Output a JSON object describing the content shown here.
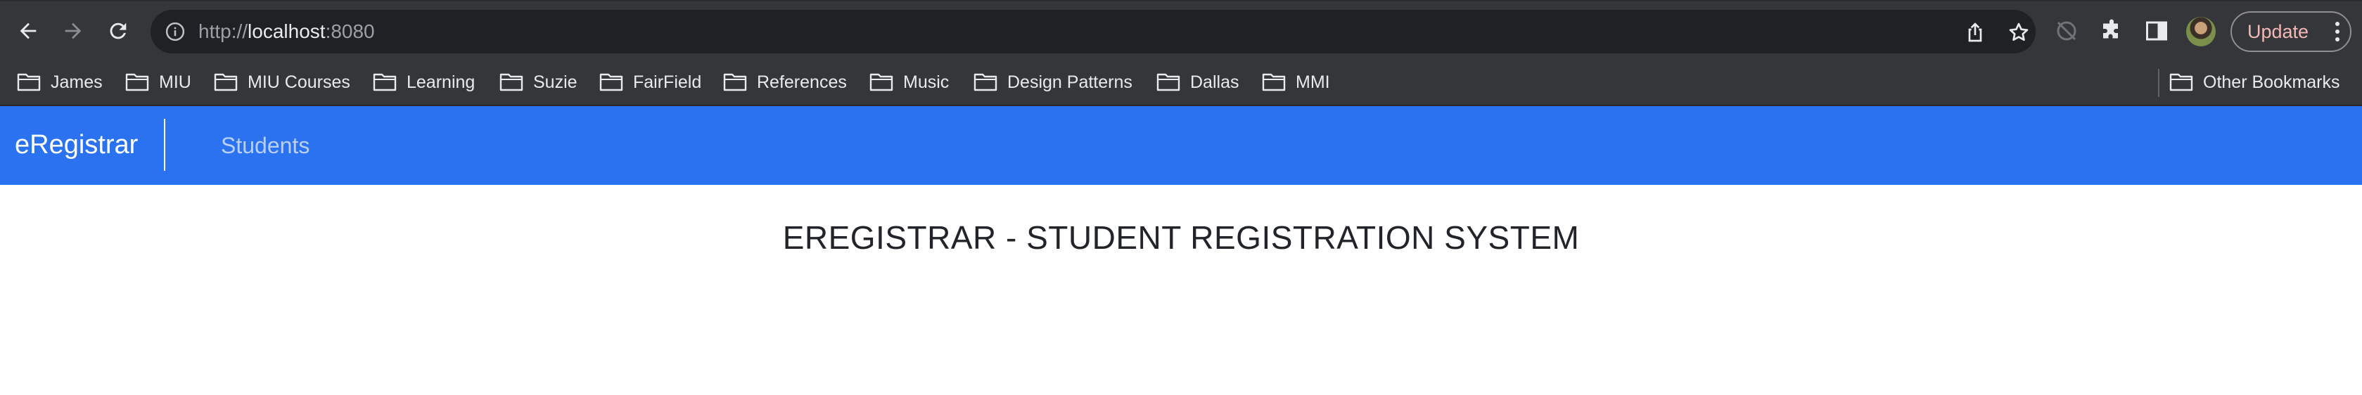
{
  "browser": {
    "url_scheme": "http://",
    "url_host": "localhost",
    "url_port": ":8080",
    "update_label": "Update",
    "icons": [
      "back-icon",
      "forward-icon",
      "reload-icon",
      "info-icon",
      "share-icon",
      "star-icon",
      "sync-off-icon",
      "extensions-icon",
      "side-panel-icon",
      "avatar",
      "more-vert-icon"
    ]
  },
  "bookmarks": {
    "items": [
      {
        "label": "James"
      },
      {
        "label": "MIU"
      },
      {
        "label": "MIU Courses"
      },
      {
        "label": "Learning"
      },
      {
        "label": "Suzie"
      },
      {
        "label": "FairField"
      },
      {
        "label": "References"
      },
      {
        "label": "Music"
      },
      {
        "label": "Design Patterns"
      },
      {
        "label": "Dallas"
      },
      {
        "label": "MMI"
      }
    ],
    "other_label": "Other Bookmarks"
  },
  "app": {
    "brand": "eRegistrar",
    "nav_links": [
      {
        "label": "Students"
      }
    ],
    "page_title": "EREGISTRAR - STUDENT REGISTRATION SYSTEM",
    "accent_color": "#2b72f0"
  }
}
